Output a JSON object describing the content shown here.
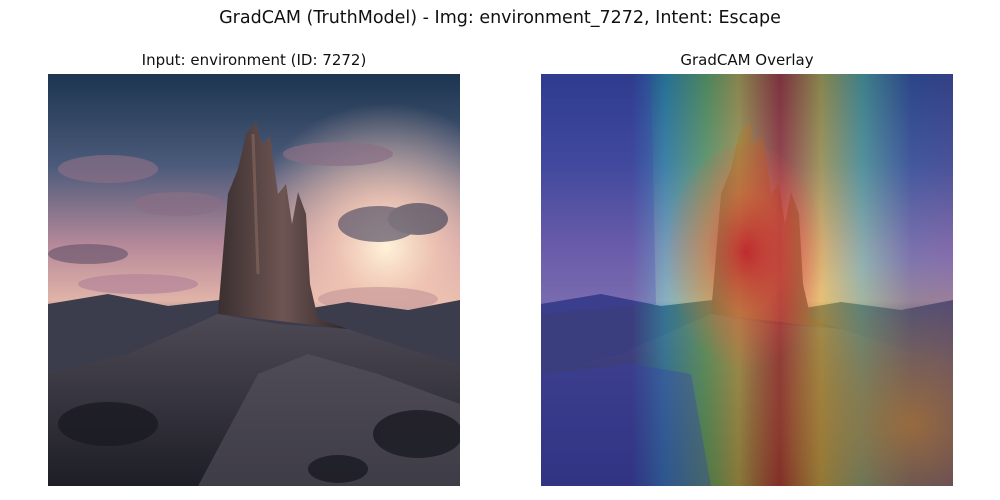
{
  "figure": {
    "suptitle": "GradCAM (TruthModel) - Img: environment_7272, Intent: Escape"
  },
  "panels": [
    {
      "title": "Input: environment (ID: 7272)",
      "kind": "photo"
    },
    {
      "title": "GradCAM Overlay",
      "kind": "heatmap-overlay"
    }
  ]
}
